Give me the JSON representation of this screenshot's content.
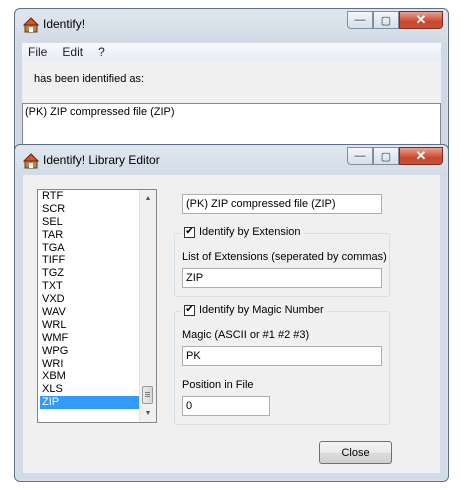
{
  "main_window": {
    "title": "Identify!",
    "menu": [
      "File",
      "Edit",
      "?"
    ],
    "identified_label": "has been identified as:",
    "result": "(PK) ZIP compressed file (ZIP)"
  },
  "editor_window": {
    "title": "Identify! Library Editor",
    "list": {
      "items": [
        "RTF",
        "SCR",
        "SEL",
        "TAR",
        "TGA",
        "TIFF",
        "TGZ",
        "TXT",
        "VXD",
        "WAV",
        "WRL",
        "WMF",
        "WPG",
        "WRI",
        "XBM",
        "XLS",
        "ZIP"
      ],
      "selected": "ZIP"
    },
    "name_value": "(PK) ZIP compressed file (ZIP)",
    "extension_group": {
      "label": "Identify by Extension",
      "checked": true,
      "list_label": "List of Extensions (seperated by commas)",
      "value": "ZIP"
    },
    "magic_group": {
      "label": "Identify by Magic Number",
      "checked": true,
      "magic_label": "Magic (ASCII or #1 #2 #3)",
      "magic_value": "PK",
      "position_label": "Position in File",
      "position_value": "0"
    },
    "close_label": "Close"
  },
  "window_controls": {
    "minimize": "—",
    "maximize": "▢",
    "close": "✕"
  },
  "colors": {
    "selection": "#3399ff",
    "close_button": "#c9472d"
  }
}
